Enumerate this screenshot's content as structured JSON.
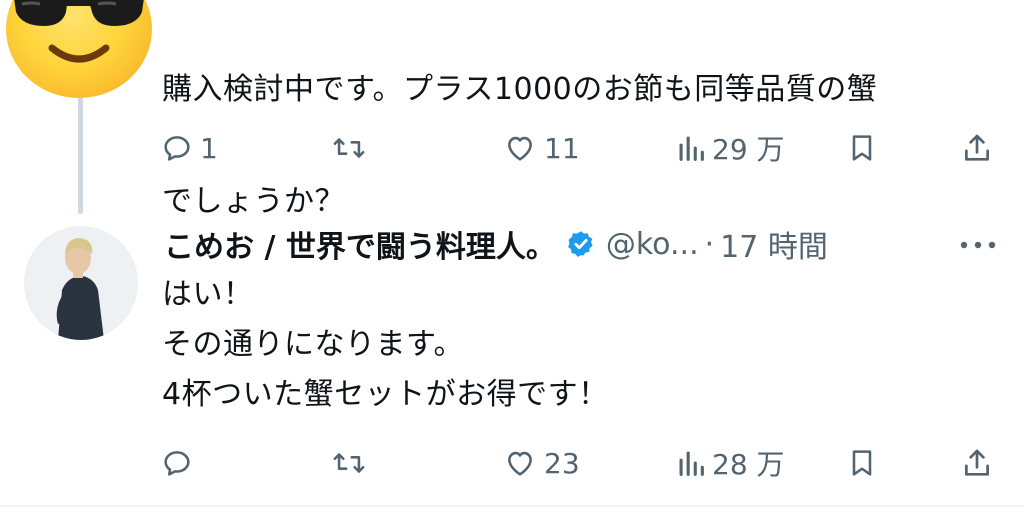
{
  "tweet1": {
    "text_lines": [
      "購入検討中です。プラス1000のお節も同等品質の蟹",
      "でしょうか？"
    ],
    "actions": {
      "reply_count": "1",
      "retweet_count": "",
      "like_count": "11",
      "view_count": "29 万"
    }
  },
  "tweet2": {
    "display_name": "こめお / 世界で闘う料理人。",
    "handle": "@ko...",
    "separator": "·",
    "time": "17 時間",
    "text_lines": [
      "はい！",
      "その通りになります。",
      "4杯ついた蟹セットがお得です！"
    ],
    "actions": {
      "reply_count": "",
      "retweet_count": "",
      "like_count": "23",
      "view_count": "28 万"
    }
  },
  "colors": {
    "text": "#0f1419",
    "secondary": "#536471",
    "verified": "#1d9bf0",
    "thread_line": "#cfd9de"
  },
  "icons": [
    "reply-icon",
    "retweet-icon",
    "like-icon",
    "views-icon",
    "bookmark-icon",
    "share-icon",
    "more-icon",
    "verified-badge-icon"
  ]
}
